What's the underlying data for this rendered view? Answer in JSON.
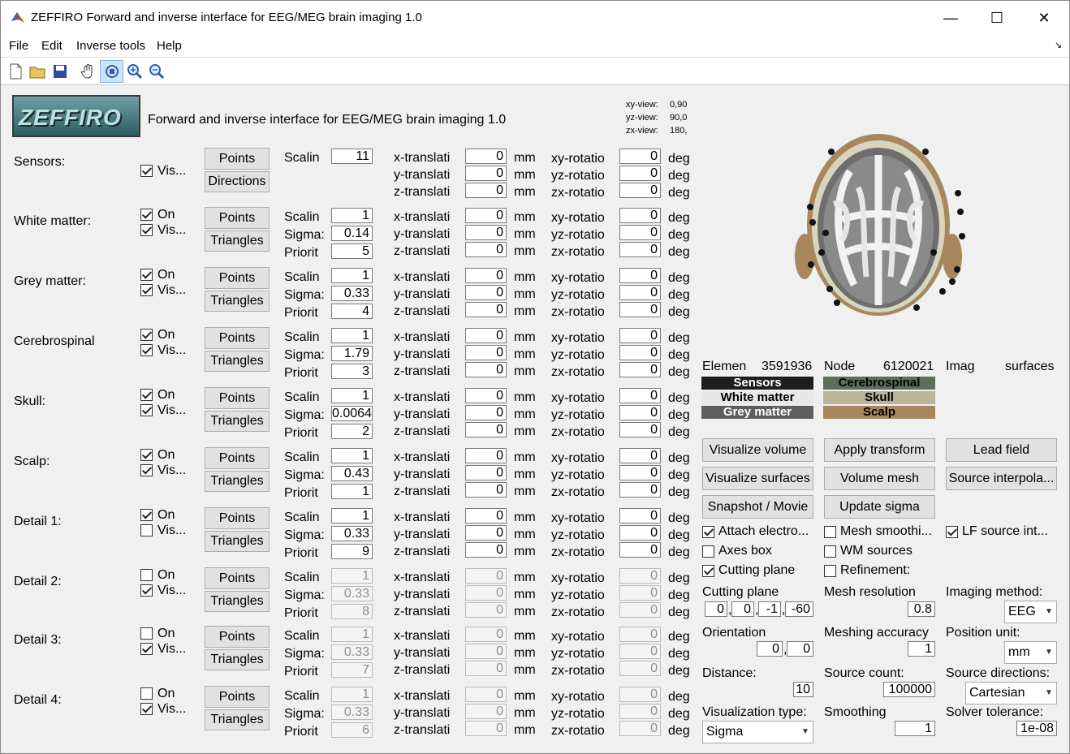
{
  "window": {
    "title": "ZEFFIRO Forward and inverse interface for EEG/MEG brain imaging 1.0"
  },
  "menu": [
    "File",
    "Edit",
    "Inverse tools",
    "Help"
  ],
  "toolbar_icons": [
    "new-file-icon",
    "open-folder-icon",
    "save-icon",
    "pan-hand-icon",
    "rotate-3d-icon",
    "zoom-in-icon",
    "zoom-out-icon"
  ],
  "header": {
    "logo_text": "ZEFFIRO",
    "subtitle": "Forward and inverse interface for EEG/MEG brain imaging 1.0"
  },
  "views": {
    "xy_label": "xy-view:",
    "xy_value": "0,90",
    "yz_label": "yz-view:",
    "yz_value": "90,0",
    "zx_label": "zx-view:",
    "zx_value": "180,"
  },
  "labels": {
    "on": "On",
    "vis": "Vis...",
    "points": "Points",
    "directions": "Directions",
    "triangles": "Triangles",
    "scaling": "Scalin",
    "sigma": "Sigma:",
    "priority": "Priorit",
    "xt": "x-translati",
    "yt": "y-translati",
    "zt": "z-translati",
    "xr": "xy-rotatio",
    "yr": "yz-rotatio",
    "zr": "zx-rotatio",
    "mm": "mm",
    "deg": "deg"
  },
  "layers": [
    {
      "name": "Sensors:",
      "on": null,
      "vis": true,
      "scaling": "11",
      "sigma": null,
      "priority": null,
      "enabled": true,
      "second_button": "Directions"
    },
    {
      "name": "White matter:",
      "on": true,
      "vis": true,
      "scaling": "1",
      "sigma": "0.14",
      "priority": "5",
      "enabled": true,
      "second_button": "Triangles"
    },
    {
      "name": "Grey matter:",
      "on": true,
      "vis": true,
      "scaling": "1",
      "sigma": "0.33",
      "priority": "4",
      "enabled": true,
      "second_button": "Triangles"
    },
    {
      "name": "Cerebrospinal",
      "on": true,
      "vis": true,
      "scaling": "1",
      "sigma": "1.79",
      "priority": "3",
      "enabled": true,
      "second_button": "Triangles"
    },
    {
      "name": "Skull:",
      "on": true,
      "vis": true,
      "scaling": "1",
      "sigma": "0.0064",
      "priority": "2",
      "enabled": true,
      "second_button": "Triangles"
    },
    {
      "name": "Scalp:",
      "on": true,
      "vis": true,
      "scaling": "1",
      "sigma": "0.43",
      "priority": "1",
      "enabled": true,
      "second_button": "Triangles"
    },
    {
      "name": "Detail 1:",
      "on": true,
      "vis": false,
      "scaling": "1",
      "sigma": "0.33",
      "priority": "9",
      "enabled": true,
      "second_button": "Triangles"
    },
    {
      "name": "Detail 2:",
      "on": false,
      "vis": true,
      "scaling": "1",
      "sigma": "0.33",
      "priority": "8",
      "enabled": false,
      "second_button": "Triangles"
    },
    {
      "name": "Detail 3:",
      "on": false,
      "vis": true,
      "scaling": "1",
      "sigma": "0.33",
      "priority": "7",
      "enabled": false,
      "second_button": "Triangles"
    },
    {
      "name": "Detail 4:",
      "on": false,
      "vis": true,
      "scaling": "1",
      "sigma": "0.33",
      "priority": "6",
      "enabled": false,
      "second_button": "Triangles"
    }
  ],
  "transform_value": "0",
  "stats": {
    "elements_label": "Elemen",
    "elements": "3591936",
    "nodes_label": "Node",
    "nodes": "6120021",
    "image_label": "Imag",
    "surfaces": "surfaces"
  },
  "legend": [
    {
      "name": "Sensors",
      "color": "#1e1e1e",
      "text": "#ffffff"
    },
    {
      "name": "Cerebrospinal",
      "color": "#5f6e5a",
      "text": "#000000"
    },
    {
      "name": "White matter",
      "color": "#e8e8e8",
      "text": "#000000"
    },
    {
      "name": "Skull",
      "color": "#b9b59a",
      "text": "#000000"
    },
    {
      "name": "Grey matter",
      "color": "#5e5e5e",
      "text": "#ffffff"
    },
    {
      "name": "Scalp",
      "color": "#a8875c",
      "text": "#000000"
    }
  ],
  "actions": [
    "Visualize volume",
    "Apply transform",
    "Lead field",
    "Visualize surfaces",
    "Volume mesh",
    "Source interpola...",
    "Snapshot / Movie",
    "Update sigma"
  ],
  "options": [
    {
      "label": "Attach electro...",
      "checked": true
    },
    {
      "label": "Mesh smoothi...",
      "checked": false
    },
    {
      "label": "LF source int...",
      "checked": true
    },
    {
      "label": "Axes box",
      "checked": false
    },
    {
      "label": "WM sources",
      "checked": false
    },
    {
      "label": "Cutting plane",
      "checked": true
    },
    {
      "label": "Refinement:",
      "checked": false
    }
  ],
  "settings": {
    "cutting_plane_label": "Cutting plane",
    "cutting_plane": [
      "0",
      "0",
      "-1",
      "-60"
    ],
    "mesh_resolution_label": "Mesh resolution",
    "mesh_resolution": "0.8",
    "imaging_method_label": "Imaging method:",
    "imaging_method": "EEG",
    "orientation_label": "Orientation",
    "orientation": [
      "0",
      "0"
    ],
    "meshing_accuracy_label": "Meshing accuracy",
    "meshing_accuracy": "1",
    "position_unit_label": "Position unit:",
    "position_unit": "mm",
    "distance_label": "Distance:",
    "distance": "10",
    "source_count_label": "Source count:",
    "source_count": "100000",
    "source_directions_label": "Source directions:",
    "source_directions": "Cartesian",
    "visualization_type_label": "Visualization type:",
    "visualization_type": "Sigma",
    "smoothing_label": "Smoothing",
    "smoothing": "1",
    "solver_tolerance_label": "Solver tolerance:",
    "solver_tolerance": "1e-08"
  }
}
